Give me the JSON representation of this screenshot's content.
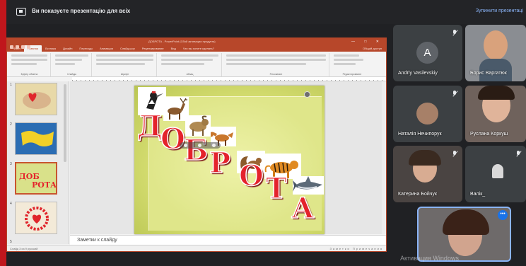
{
  "top_bar": {
    "presenting_text": "Ви показуєте презентацію для всіх",
    "stop_label": "Зупинити презентаці"
  },
  "powerpoint": {
    "window_title": "ДОБРОТА - PowerPoint (Сбой активации продукта)",
    "tabs": [
      "Файл",
      "Главная",
      "Вставка",
      "Дизайн",
      "Переходы",
      "Анимация",
      "Слайд-шоу",
      "Рецензирование",
      "Вид",
      "Что вы хотите сделать?"
    ],
    "active_tab": "Главная",
    "share_label": "Общий доступ",
    "ribbon_groups": [
      "Буфер обмена",
      "Слайды",
      "Шрифт",
      "Абзац",
      "Рисование",
      "Редактирование"
    ],
    "thumb_numbers": [
      "1",
      "2",
      "3",
      "4",
      "5"
    ],
    "slide_word": [
      "Д",
      "О",
      "Б",
      "Р",
      "О",
      "Т",
      "А"
    ],
    "notes_placeholder": "Заметки к слайду",
    "status_left": "Слайд 3 из 9   русский",
    "status_right": "Заметки   Примечания"
  },
  "participants": [
    {
      "name": "Andriy Vasilevskiy",
      "initial": "A",
      "muted": true
    },
    {
      "name": "Борис Варгатюк",
      "muted": false
    },
    {
      "name": "Наталія Нечипорук",
      "muted": true
    },
    {
      "name": "Руслана Коркуш",
      "muted": false
    },
    {
      "name": "Катерина Бойчук",
      "muted": true
    },
    {
      "name": "Валік_",
      "muted": true
    }
  ],
  "self_view": {
    "more_label": "•••"
  },
  "watermark": "Активация Windows"
}
